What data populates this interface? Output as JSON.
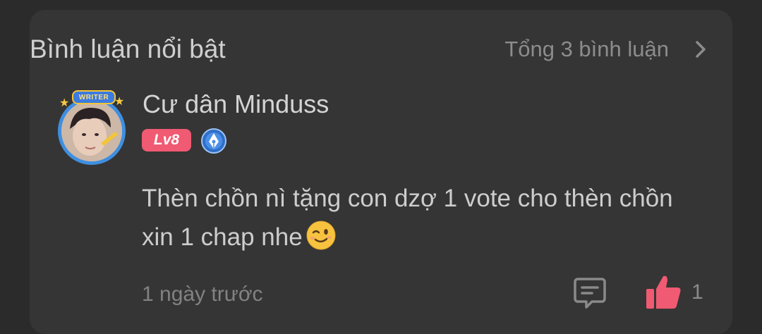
{
  "card": {
    "title": "Bình luận nổi bật",
    "total_label": "Tổng 3 bình luận",
    "chevron_icon": "chevron-right-icon"
  },
  "comment": {
    "avatar": {
      "badge_text": "WRITER",
      "ring_color": "#3f8fe0"
    },
    "username": "Cư dân Minduss",
    "level": "Lv8",
    "level_color": "#f05a72",
    "author_icon": "writer-pen-icon",
    "body": "Thèn chồn nì tặng con dzợ 1 vote cho thèn chồn xin 1 chap nhe",
    "emoji": "winking-face-emoji",
    "timestamp": "1 ngày trước",
    "reply_icon": "comment-icon",
    "like_icon": "thumbs-up-icon",
    "like_color": "#f05a72",
    "like_count": "1"
  }
}
